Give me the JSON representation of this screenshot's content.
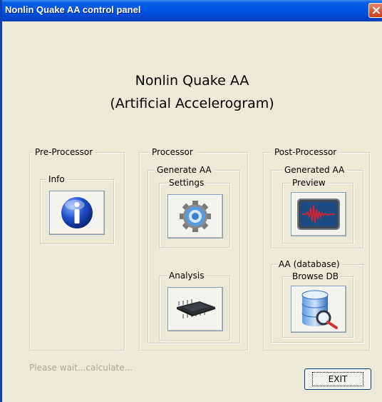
{
  "window": {
    "title": "Nonlin Quake AA control panel"
  },
  "heading": {
    "line1": "Nonlin Quake AA",
    "line2": "(Artificial Accelerogram)"
  },
  "pre": {
    "label": "Pre-Processor",
    "info": "Info"
  },
  "proc": {
    "label": "Processor",
    "generate": "Generate AA",
    "settings": "Settings",
    "analysis": "Analysis"
  },
  "post": {
    "label": "Post-Processor",
    "generated": "Generated AA",
    "preview": "Preview",
    "database": "AA (database)",
    "browse": "Browse DB"
  },
  "status": "Please wait...calculate...",
  "exit_label": "EXIT",
  "icons": {
    "info": "info-icon",
    "settings": "gear-icon",
    "analysis": "chip-icon",
    "preview": "waveform-monitor-icon",
    "browse": "database-search-icon"
  },
  "colors": {
    "titlebar": "#0055e5",
    "panel": "#ece9d8",
    "status_text": "#aca899"
  }
}
